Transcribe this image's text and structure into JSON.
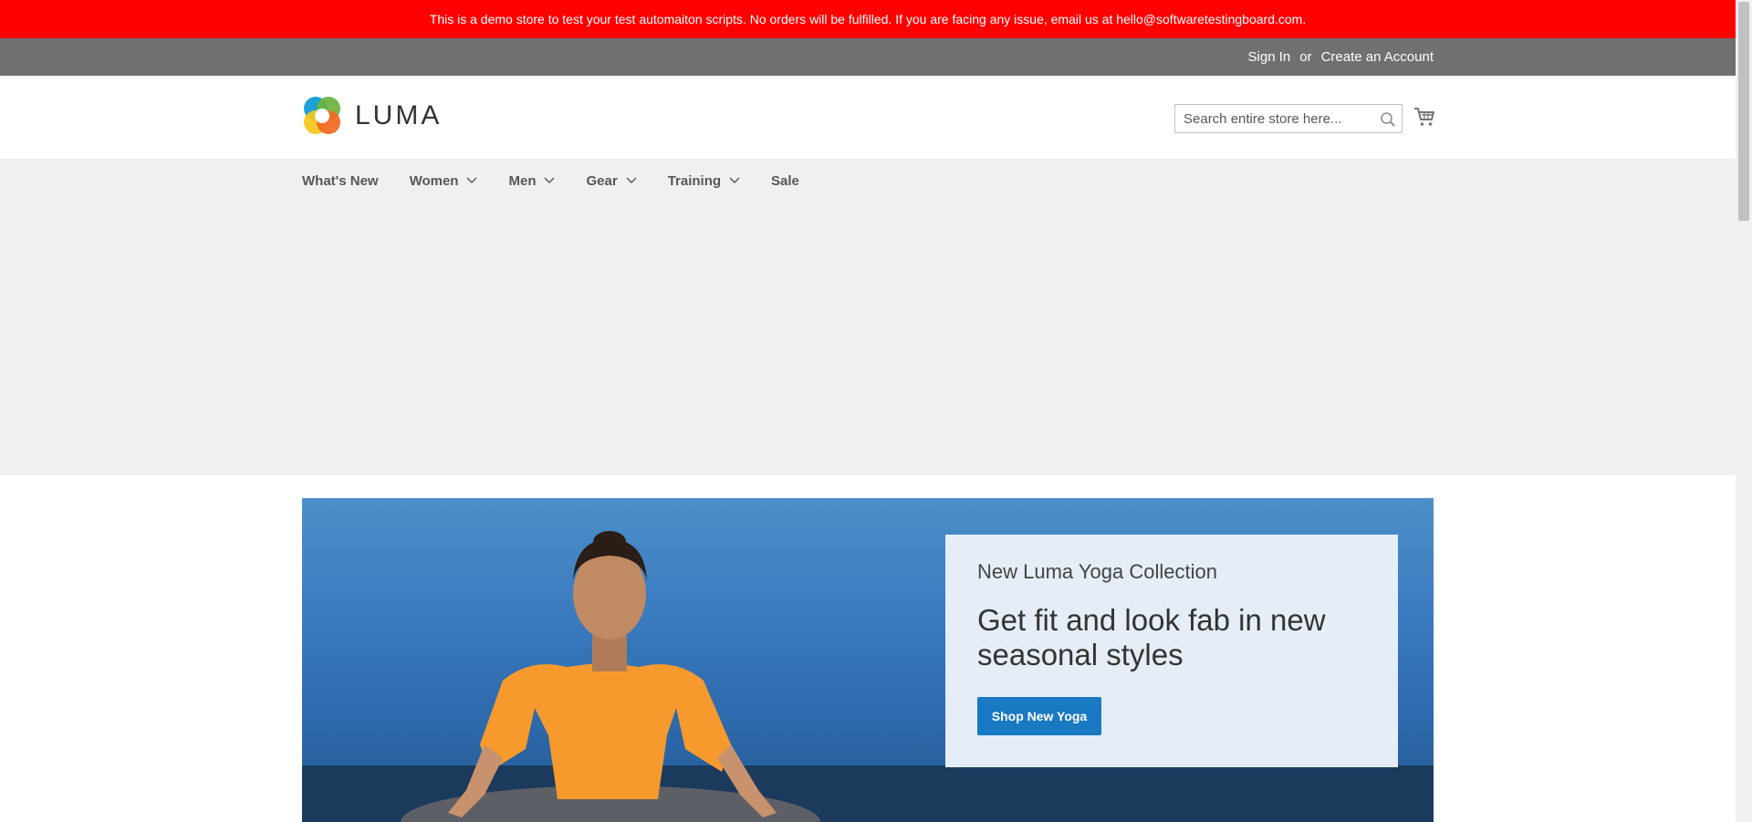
{
  "demo_banner": {
    "text": "This is a demo store to test your test automaiton scripts. No orders will be fulfilled. If you are facing any issue, email us at hello@softwaretestingboard.com."
  },
  "header_links": {
    "sign_in": "Sign In",
    "separator": "or",
    "create_account": "Create an Account"
  },
  "logo": {
    "text": "LUMA",
    "icon": "luma-logo-icon"
  },
  "search": {
    "placeholder": "Search entire store here...",
    "value": "",
    "icon": "search-icon"
  },
  "cart": {
    "icon": "cart-icon"
  },
  "nav": {
    "items": [
      {
        "label": "What's New",
        "has_dropdown": false
      },
      {
        "label": "Women",
        "has_dropdown": true
      },
      {
        "label": "Men",
        "has_dropdown": true
      },
      {
        "label": "Gear",
        "has_dropdown": true
      },
      {
        "label": "Training",
        "has_dropdown": true
      },
      {
        "label": "Sale",
        "has_dropdown": false
      }
    ]
  },
  "hero": {
    "subtitle": "New Luma Yoga Collection",
    "title": "Get fit and look fab in new seasonal styles",
    "button_label": "Shop New Yoga"
  },
  "colors": {
    "banner": "#ff0000",
    "panel_header": "#6e716e",
    "nav_bg": "#f0f0f0",
    "primary_button": "#1979c3"
  }
}
